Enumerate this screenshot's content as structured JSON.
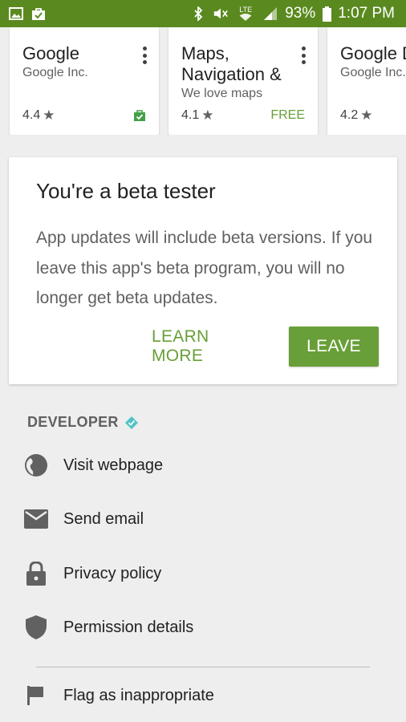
{
  "status_bar": {
    "network": "LTE",
    "battery": "93%",
    "time": "1:07 PM",
    "icons": [
      "image-icon",
      "store-notification-icon",
      "bluetooth-icon",
      "mute-icon",
      "wifi-icon",
      "signal-icon",
      "battery-icon"
    ]
  },
  "app_cards": [
    {
      "title": "Google",
      "developer": "Google Inc.",
      "rating": "4.4",
      "price": "",
      "installed": true
    },
    {
      "title": "Maps, Navigation &",
      "developer": "We love maps",
      "rating": "4.1",
      "price": "FREE",
      "installed": false
    },
    {
      "title": "Google Docs",
      "developer": "Google Inc.",
      "rating": "4.2",
      "price": "",
      "installed": false
    }
  ],
  "beta_card": {
    "title": "You're a beta tester",
    "body": "App updates will include beta versions. If you leave this app's beta program, you will no longer get beta updates.",
    "learn_more": "LEARN MORE",
    "leave": "LEAVE"
  },
  "developer": {
    "header": "DEVELOPER",
    "items": [
      {
        "label": "Visit webpage",
        "icon": "globe-icon"
      },
      {
        "label": "Send email",
        "icon": "email-icon"
      },
      {
        "label": "Privacy policy",
        "icon": "lock-icon"
      },
      {
        "label": "Permission details",
        "icon": "shield-icon"
      },
      {
        "label": "Flag as inappropriate",
        "icon": "flag-icon"
      }
    ]
  },
  "colors": {
    "status_bar": "#5a8a1f",
    "accent": "#689f38",
    "badge": "#4fc3c7"
  }
}
